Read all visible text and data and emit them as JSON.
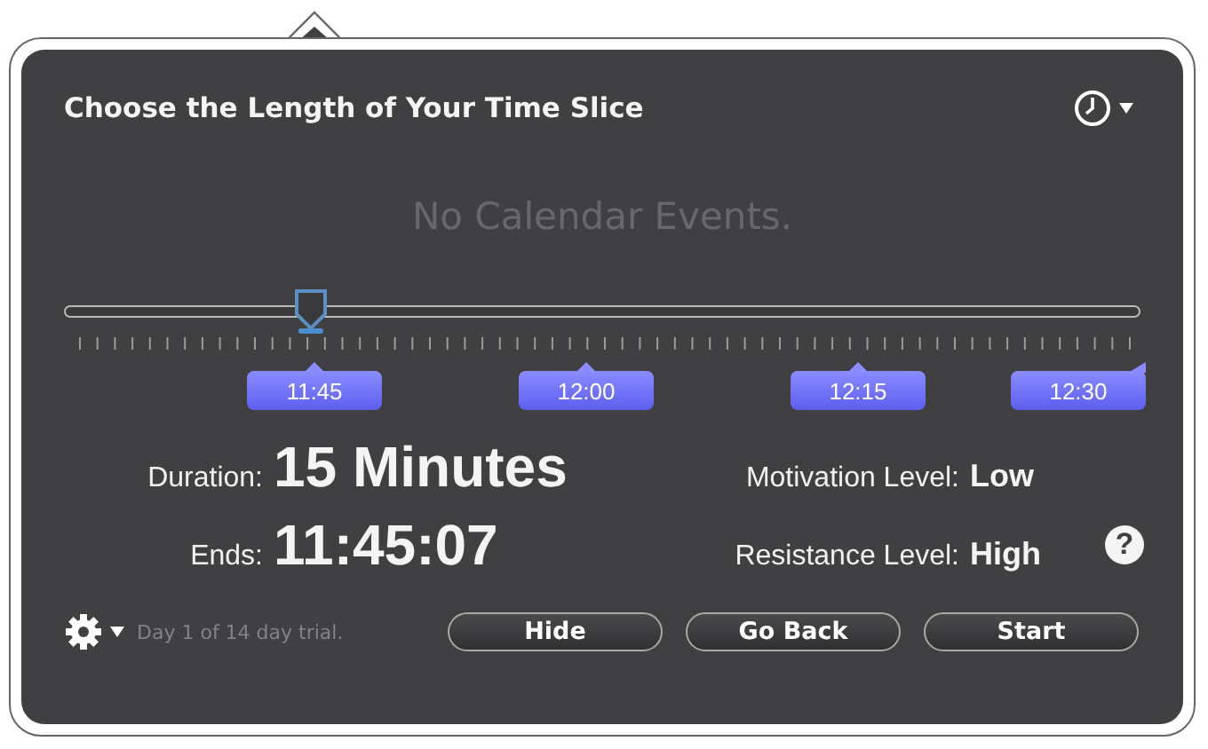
{
  "title": "Choose the Length of Your Time Slice",
  "empty_message": "No Calendar Events.",
  "slider": {
    "level": 0.23,
    "labels": [
      "11:45",
      "12:00",
      "12:15",
      "12:30"
    ]
  },
  "stats": [
    {
      "label": "Duration:",
      "value": "15 Minutes"
    },
    {
      "label": "Ends:",
      "value": "11:45:07"
    }
  ],
  "levels": [
    {
      "label": "Motivation Level:",
      "value": "Low"
    },
    {
      "label": "Resistance Level:",
      "value": "High"
    }
  ],
  "help": "?",
  "trial": "Day 1 of 14 day trial.",
  "buttons": [
    "Hide",
    "Go Back",
    "Start"
  ]
}
